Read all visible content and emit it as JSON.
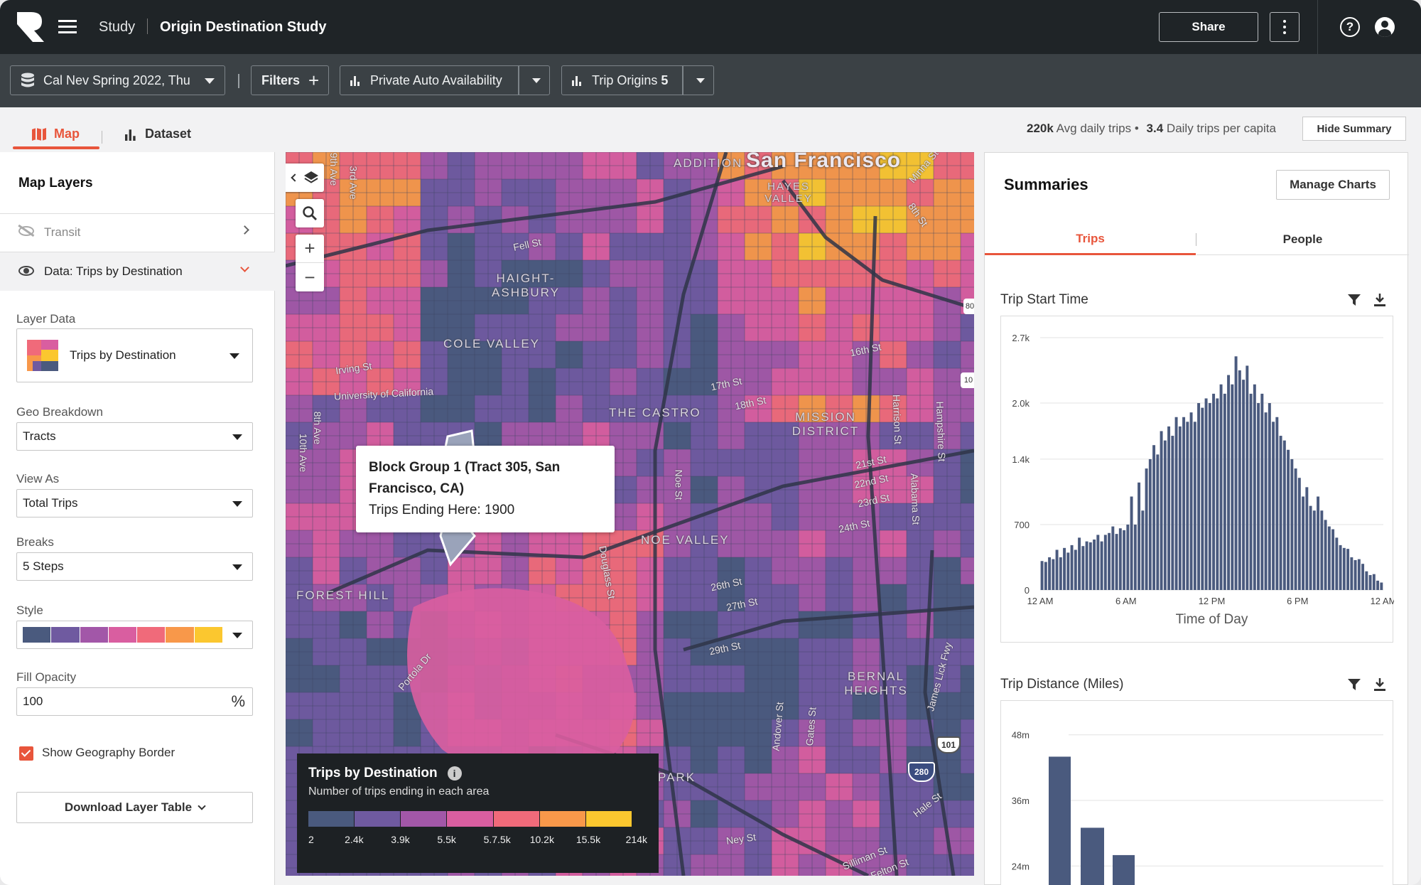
{
  "header": {
    "study_label": "Study",
    "title": "Origin Destination Study",
    "share_label": "Share"
  },
  "toolbar": {
    "dataset": "Cal Nev Spring 2022, Thu",
    "filters": "Filters",
    "availability": "Private Auto Availability",
    "metric": "Trip Origins",
    "metric_count": "5"
  },
  "view_tabs": {
    "map": "Map",
    "dataset": "Dataset"
  },
  "summary_stats": {
    "avg_trips_value": "220k",
    "avg_trips_label": "Avg daily trips",
    "per_capita_value": "3.4",
    "per_capita_label": "Daily trips per capita",
    "hide_button": "Hide Summary"
  },
  "left_panel": {
    "title": "Map Layers",
    "layers": [
      {
        "label": "Transit"
      },
      {
        "label": "Data: Trips by Destination"
      }
    ],
    "layer_data_label": "Layer Data",
    "layer_data_value": "Trips by Destination",
    "geo_label": "Geo Breakdown",
    "geo_value": "Tracts",
    "view_as_label": "View As",
    "view_as_value": "Total Trips",
    "breaks_label": "Breaks",
    "breaks_value": "5 Steps",
    "style_label": "Style",
    "style_colors": [
      "#4a5a7e",
      "#6f5aa0",
      "#a257a8",
      "#d95ea0",
      "#f06a7a",
      "#f8984a",
      "#fbc72f"
    ],
    "opacity_label": "Fill Opacity",
    "opacity_value": "100",
    "opacity_unit": "%",
    "border_label": "Show Geography Border",
    "border_checked": true,
    "download_label": "Download Layer Table"
  },
  "map": {
    "city_label": "San Francisco",
    "districts": [
      "ADDITION",
      "HAYES VALLEY",
      "HAIGHT-ASHBURY",
      "COLE VALLEY",
      "THE CASTRO",
      "MISSION DISTRICT",
      "NOE VALLEY",
      "FOREST HILL",
      "BERNAL HEIGHTS",
      "PARK"
    ],
    "streets": [
      "Fell St",
      "Irving St",
      "University of California",
      "17th St",
      "18th St",
      "16th St",
      "21st St",
      "22nd St",
      "23rd St",
      "24th St",
      "26th St",
      "27th St",
      "29th St",
      "Noe St",
      "Douglass St",
      "Harrison St",
      "Hampshire St",
      "Alabama St",
      "Portola Dr",
      "Andover St",
      "Gates St",
      "Ney St",
      "Hale St",
      "Silliman St",
      "Felton St",
      "8th St",
      "Minna St",
      "10th Ave",
      "8th Ave",
      "3rd Ave",
      "9th Ave",
      "James Lick Fwy"
    ],
    "shields": [
      "101",
      "280",
      "10",
      "80"
    ],
    "tooltip": {
      "title": "Block Group 1 (Tract 305, San Francisco, CA)",
      "line": "Trips Ending Here: 1900"
    },
    "legend": {
      "title": "Trips by Destination",
      "subtitle": "Number of trips ending in each area",
      "ticks": [
        "2",
        "2.4k",
        "3.9k",
        "5.5k",
        "5.7.5k",
        "10.2k",
        "15.5k",
        "214k"
      ],
      "colors": [
        "#4a5a7e",
        "#6f5aa0",
        "#a257a8",
        "#d95ea0",
        "#f06a7a",
        "#f8984a",
        "#fbc72f"
      ]
    }
  },
  "summaries": {
    "title": "Summaries",
    "manage_button": "Manage Charts",
    "tabs": [
      "Trips",
      "People"
    ],
    "active_tab": "Trips"
  },
  "chart_data": [
    {
      "type": "bar",
      "title": "Trip Start Time",
      "xlabel": "Time of Day",
      "ylabel": "",
      "x_tick_labels": [
        "12 AM",
        "6 AM",
        "12 PM",
        "6 PM",
        "12 AM"
      ],
      "y_tick_labels": [
        "0",
        "700",
        "1.4k",
        "2.0k",
        "2.7k"
      ],
      "ylim": [
        0,
        2700
      ],
      "bar_color": "#4a5a7e",
      "grid": true,
      "values": [
        310,
        300,
        350,
        330,
        430,
        350,
        450,
        400,
        480,
        430,
        560,
        470,
        520,
        510,
        540,
        590,
        520,
        590,
        610,
        680,
        600,
        660,
        640,
        700,
        1000,
        700,
        1150,
        850,
        1300,
        1400,
        1550,
        1450,
        1700,
        1600,
        1750,
        1650,
        1850,
        1750,
        1850,
        1800,
        1900,
        1800,
        2000,
        1950,
        2050,
        2000,
        2100,
        2050,
        2200,
        2100,
        2300,
        2200,
        2500,
        2350,
        2250,
        2400,
        2100,
        2200,
        2000,
        2100,
        1900,
        2000,
        1800,
        1850,
        1650,
        1600,
        1500,
        1400,
        1300,
        1200,
        1000,
        1100,
        900,
        850,
        1000,
        850,
        750,
        680,
        650,
        560,
        480,
        450,
        440,
        350,
        320,
        330,
        280,
        200,
        160,
        170,
        100,
        80
      ]
    },
    {
      "type": "bar",
      "title": "Trip Distance (Miles)",
      "xlabel": "",
      "ylabel": "",
      "y_tick_labels": [
        "24m",
        "36m",
        "48m"
      ],
      "ylim_visible": [
        23,
        49
      ],
      "bar_color": "#4a5a7e",
      "grid": true,
      "values": [
        44,
        31,
        26
      ]
    }
  ]
}
